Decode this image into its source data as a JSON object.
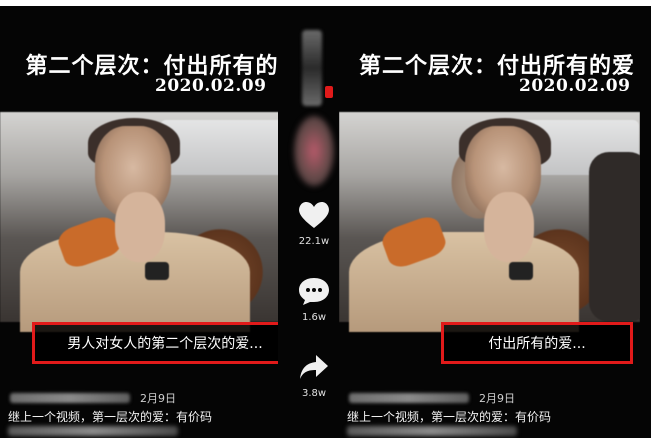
{
  "left_panel": {
    "title": "第二个层次：付出所有的爱",
    "date": "2020.02.09",
    "caption": "男人对女人的第二个层次的爱...",
    "post_date": "2月9日",
    "description": "继上一个视频，第一层次的爱：有价码"
  },
  "right_panel": {
    "title": "第二个层次：付出所有的爱",
    "date": "2020.02.09",
    "caption": "付出所有的爱...",
    "post_date": "2月9日",
    "description": "继上一个视频，第一层次的爱：有价码"
  },
  "sidebar": {
    "like_count": "22.1w",
    "comment_count": "1.6w",
    "share_count": "3.8w",
    "icons": [
      "heart-icon",
      "comment-icon",
      "share-icon"
    ]
  },
  "colors": {
    "highlight_border": "#e11a1a",
    "background": "#050505",
    "text": "#ffffff"
  }
}
